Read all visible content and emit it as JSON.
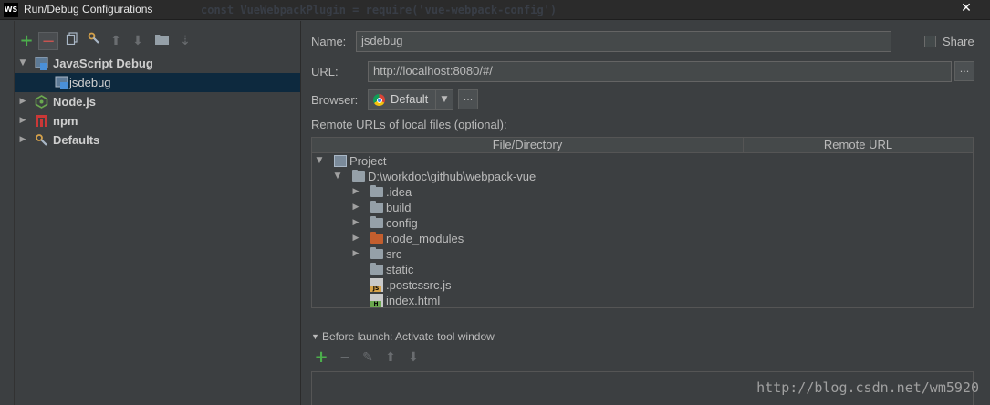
{
  "window": {
    "logo_text": "WS",
    "title": "Run/Debug Configurations",
    "background_code": "const VueWebpackPlugin = require('vue-webpack-config')"
  },
  "toolbar": {
    "add_label": "+",
    "remove_label": "−"
  },
  "tree": {
    "items": [
      {
        "label": "JavaScript Debug",
        "expanded": true,
        "icon": "js-debug-icon"
      },
      {
        "label": "jsdebug",
        "selected": true,
        "icon": "js-debug-config-icon"
      },
      {
        "label": "Node.js",
        "expanded": false,
        "icon": "nodejs-icon"
      },
      {
        "label": "npm",
        "expanded": false,
        "icon": "npm-icon"
      },
      {
        "label": "Defaults",
        "expanded": false,
        "icon": "defaults-icon"
      }
    ]
  },
  "form": {
    "name_label": "Name:",
    "name_value": "jsdebug",
    "share_label": "Share",
    "url_label": "URL:",
    "url_value": "http://localhost:8080/#/",
    "browse_label": "...",
    "browser_label": "Browser:",
    "browser_value": "Default",
    "browser_more_label": "...",
    "remote_urls_label": "Remote URLs of local files (optional):"
  },
  "table": {
    "columns": [
      "File/Directory",
      "Remote URL"
    ],
    "rows": [
      {
        "name": "Project",
        "type": "project",
        "expanded": true
      },
      {
        "name": "D:\\workdoc\\github\\webpack-vue",
        "type": "folder",
        "expanded": true
      },
      {
        "name": ".idea",
        "type": "folder",
        "expanded": false
      },
      {
        "name": "build",
        "type": "folder",
        "expanded": false
      },
      {
        "name": "config",
        "type": "folder",
        "expanded": false
      },
      {
        "name": "node_modules",
        "type": "folder-excluded",
        "expanded": false
      },
      {
        "name": "src",
        "type": "folder",
        "expanded": false
      },
      {
        "name": "static",
        "type": "folder"
      },
      {
        "name": ".postcssrc.js",
        "type": "js-file",
        "badge": "JS"
      },
      {
        "name": "index.html",
        "type": "html-file",
        "badge": "H"
      }
    ]
  },
  "before_launch": {
    "title": "Before launch: Activate tool window",
    "add_label": "+",
    "remove_label": "−"
  },
  "watermark": "http://blog.csdn.net/wm5920",
  "colors": {
    "background": "#3c3f41",
    "selection": "#0d293e",
    "add_green": "#4cae4c",
    "remove_red": "#c75450",
    "excluded_folder": "#c35e2e"
  }
}
